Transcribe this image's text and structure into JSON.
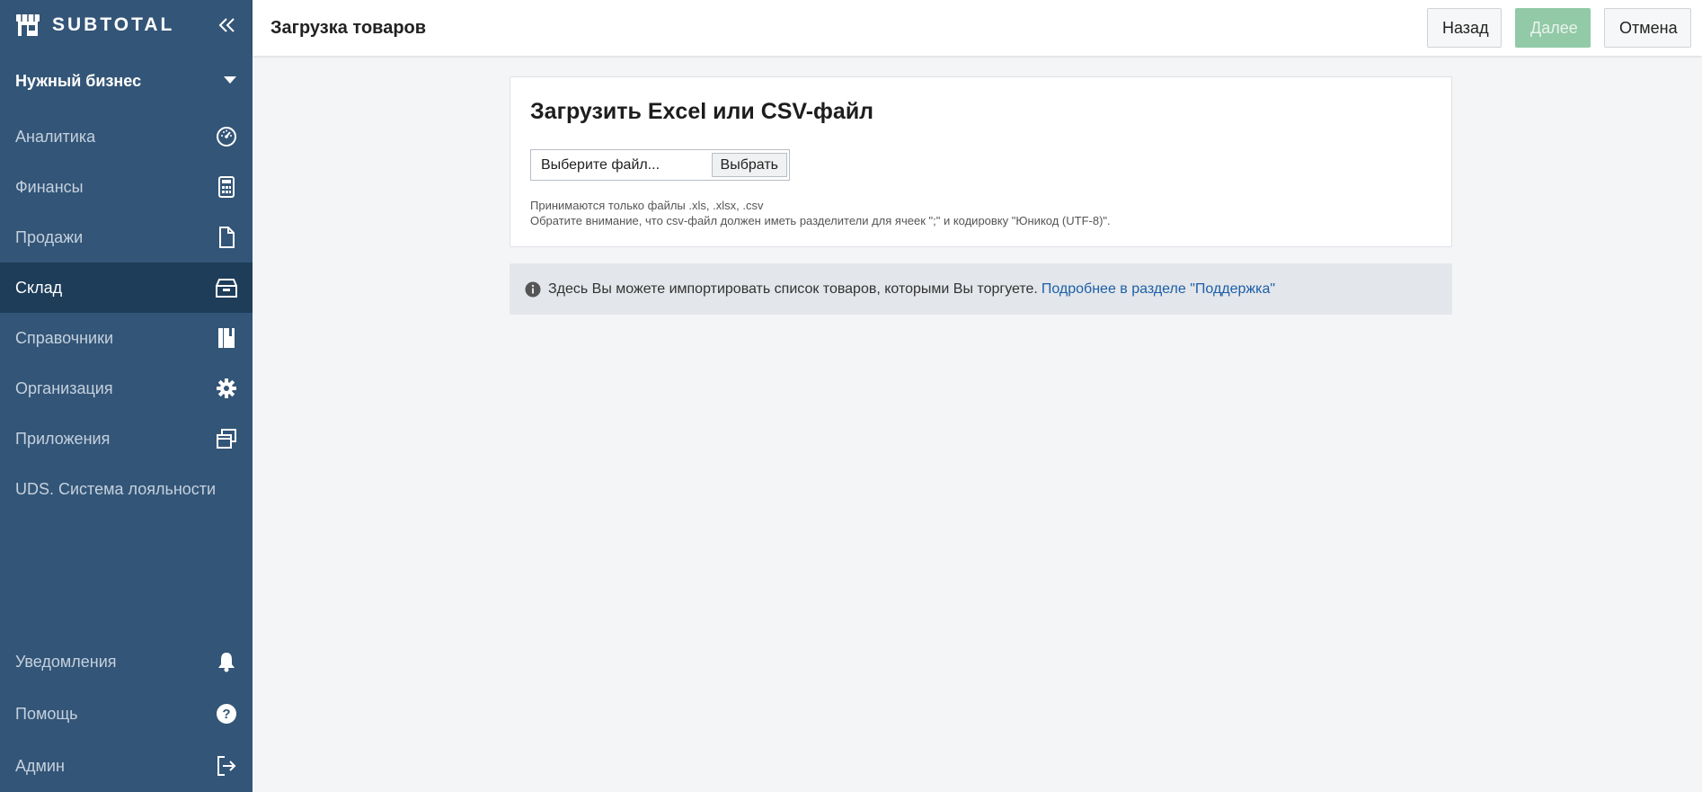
{
  "app": {
    "brand": "SUBTOTAL",
    "business_name": "Нужный бизнес"
  },
  "sidebar": {
    "items": [
      {
        "label": "Аналитика",
        "icon": "gauge-icon"
      },
      {
        "label": "Финансы",
        "icon": "calculator-icon"
      },
      {
        "label": "Продажи",
        "icon": "document-icon"
      },
      {
        "label": "Склад",
        "icon": "box-icon",
        "active": true
      },
      {
        "label": "Справочники",
        "icon": "book-icon"
      },
      {
        "label": "Организация",
        "icon": "gear-icon"
      },
      {
        "label": "Приложения",
        "icon": "windows-icon"
      },
      {
        "label": "UDS. Система лояльности",
        "icon": ""
      }
    ],
    "bottom_items": [
      {
        "label": "Уведомления",
        "icon": "bell-icon"
      },
      {
        "label": "Помощь",
        "icon": "help-icon"
      },
      {
        "label": "Админ",
        "icon": "logout-icon"
      }
    ]
  },
  "header": {
    "title": "Загрузка товаров",
    "back_label": "Назад",
    "next_label": "Далее",
    "cancel_label": "Отмена"
  },
  "upload": {
    "title": "Загрузить Excel или CSV-файл",
    "file_placeholder": "Выберите файл...",
    "choose_label": "Выбрать",
    "hint_line1": "Принимаются только файлы .xls, .xlsx, .csv",
    "hint_line2": "Обратите внимание, что csv-файл должен иметь разделители для ячеек \";\" и кодировку \"Юникод (UTF-8)\"."
  },
  "info": {
    "text": "Здесь Вы можете импортировать список товаров, которыми Вы торгуете.",
    "link": "Подробнее в разделе \"Поддержка\""
  },
  "colors": {
    "sidebar_bg": "#335577",
    "sidebar_active": "#1e3d59",
    "next_button_disabled": "#92c9a7",
    "link": "#1c5fa8"
  }
}
